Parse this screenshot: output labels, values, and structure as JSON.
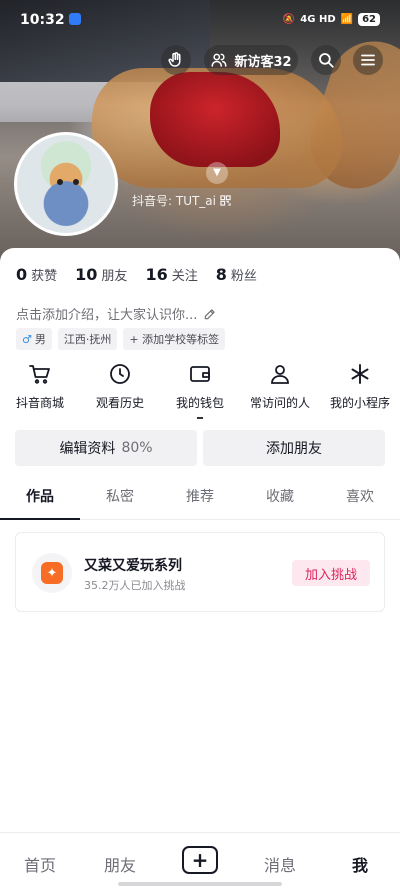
{
  "status_bar": {
    "time": "10:32",
    "network": "4G HD",
    "battery": "62"
  },
  "header": {
    "visitor_label": "新访客32",
    "douyin_id": "抖音号: TUT_ai"
  },
  "stats": [
    {
      "num": "0",
      "label": "获赞"
    },
    {
      "num": "10",
      "label": "朋友"
    },
    {
      "num": "16",
      "label": "关注"
    },
    {
      "num": "8",
      "label": "粉丝"
    }
  ],
  "bio": "点击添加介绍，让大家认识你...",
  "tags": {
    "gender": "男",
    "location": "江西·抚州",
    "school": "+ 添加学校等标签"
  },
  "shortcuts": [
    {
      "label": "抖音商城",
      "icon": "cart-icon"
    },
    {
      "label": "观看历史",
      "icon": "clock-icon"
    },
    {
      "label": "我的钱包",
      "icon": "wallet-icon"
    },
    {
      "label": "常访问的人",
      "icon": "person-icon"
    },
    {
      "label": "我的小程序",
      "icon": "asterisk-icon"
    }
  ],
  "actions": {
    "edit_profile": "编辑资料",
    "edit_percent": "80%",
    "add_friend": "添加朋友"
  },
  "tabs": [
    "作品",
    "私密",
    "推荐",
    "收藏",
    "喜欢"
  ],
  "challenge": {
    "title": "又菜又爱玩系列",
    "subtitle": "35.2万人已加入挑战",
    "button": "加入挑战"
  },
  "bottom_nav": {
    "home": "首页",
    "friends": "朋友",
    "messages": "消息",
    "me": "我"
  }
}
